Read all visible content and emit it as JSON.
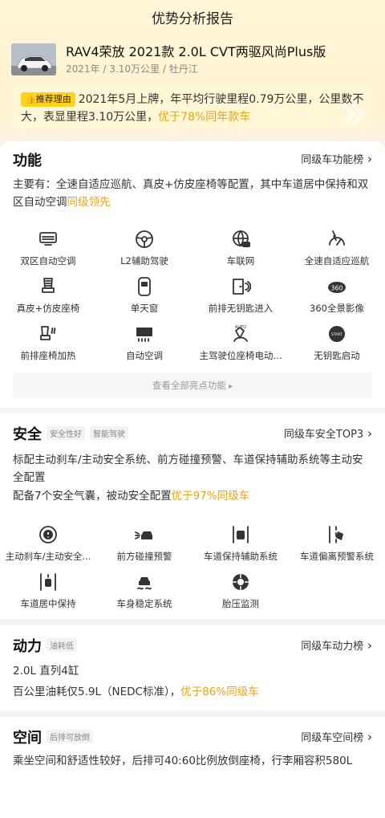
{
  "header": {
    "title": "优势分析报告"
  },
  "car": {
    "name": "RAV4荣放 2021款 2.0L CVT两驱风尚Plus版",
    "year": "2021年",
    "mileage": "3.10万公里",
    "city": "牡丹江",
    "sep": "/"
  },
  "recommend": {
    "tag": "推荐理由",
    "text": "2021年5月上牌，年平均行驶里程0.79万公里，公里数不大，表显里程3.10万公里，",
    "highlight": "优于78%同年款车"
  },
  "function": {
    "title": "功能",
    "link": "同级车功能榜",
    "text": "主要有：全速自适应巡航、真皮+仿皮座椅等配置，其中车道居中保持和双区自动空调",
    "highlight": "同级领先",
    "items": [
      {
        "label": "双区自动空调",
        "icon": "dual-zone-ac-icon"
      },
      {
        "label": "L2辅助驾驶",
        "icon": "steering-wheel-icon"
      },
      {
        "label": "车联网",
        "icon": "connected-car-icon"
      },
      {
        "label": "全速自适应巡航",
        "icon": "adaptive-cruise-icon"
      },
      {
        "label": "真皮+仿皮座椅",
        "icon": "leather-seat-icon"
      },
      {
        "label": "单天窗",
        "icon": "sunroof-icon"
      },
      {
        "label": "前排无钥匙进入",
        "icon": "keyless-entry-icon"
      },
      {
        "label": "360全景影像",
        "icon": "camera-360-icon"
      },
      {
        "label": "前排座椅加热",
        "icon": "seat-heating-icon"
      },
      {
        "label": "自动空调",
        "icon": "auto-ac-icon"
      },
      {
        "label": "主驾驶位座椅电动...",
        "icon": "power-seat-icon"
      },
      {
        "label": "无钥匙启动",
        "icon": "keyless-start-icon"
      }
    ],
    "more": "查看全部亮点功能"
  },
  "safety": {
    "title": "安全",
    "tags": [
      "安全性好",
      "智能驾驶"
    ],
    "link": "同级车安全TOP3",
    "text1": "标配主动刹车/主动安全系统、前方碰撞预警、车道保持辅助系统等主动安全配置",
    "text2": "配备7个安全气囊，被动安全配置",
    "highlight": "优于97%同级车",
    "items": [
      {
        "label": "主动刹车/主动安全...",
        "icon": "active-brake-icon"
      },
      {
        "label": "前方碰撞预警",
        "icon": "collision-warning-icon"
      },
      {
        "label": "车道保持辅助系统",
        "icon": "lane-keep-icon"
      },
      {
        "label": "车道偏离预警系统",
        "icon": "lane-departure-icon"
      },
      {
        "label": "车道居中保持",
        "icon": "lane-center-icon"
      },
      {
        "label": "车身稳定系统",
        "icon": "stability-icon"
      },
      {
        "label": "胎压监测",
        "icon": "tire-pressure-icon"
      }
    ]
  },
  "power": {
    "title": "动力",
    "tag": "油耗低",
    "link": "同级车动力榜",
    "engine": "2.0L 直列4缸",
    "text": "百公里油耗仅5.9L（NEDC标准），",
    "highlight": "优于86%同级车"
  },
  "space": {
    "title": "空间",
    "tag": "后排可放倒",
    "link": "同级车空间榜",
    "text": "乘坐空间和舒适性较好，后排可40:60比例放倒座椅，行李厢容积580L"
  },
  "colors": {
    "accent": "#e8a317",
    "tag_yellow": "#ffd21f",
    "banner": "#fff7d6"
  }
}
